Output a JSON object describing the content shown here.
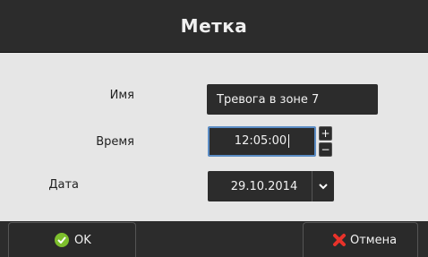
{
  "dialog": {
    "title": "Метка",
    "name_label": "Имя",
    "name_value": "Тревога в зоне 7",
    "time_label": "Время",
    "time_value": "12:05:00",
    "spin_up": "+",
    "spin_down": "−",
    "date_label": "Дата",
    "date_value": "29.10.2014"
  },
  "buttons": {
    "ok_label": "OK",
    "cancel_label": "Отмена"
  },
  "icons": {
    "ok": "check-circle-icon",
    "cancel": "red-x-icon",
    "dropdown": "chevron-down-icon"
  },
  "colors": {
    "accent_focus": "#5b8cc4",
    "ok_icon": "#7dbf2d",
    "cancel_icon": "#e8322a"
  }
}
